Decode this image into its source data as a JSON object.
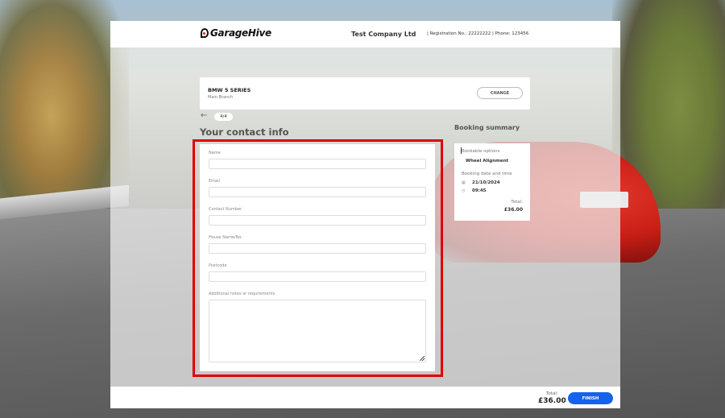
{
  "header": {
    "logo_text": "GarageHive",
    "company_name": "Test Company Ltd",
    "registration": "|  Registration No.: 22222222  |  Phone: 123456"
  },
  "vehicle": {
    "title": "BMW 5 SERIES",
    "branch": "Main Branch",
    "change_label": "CHANGE"
  },
  "step": {
    "back_symbol": "←",
    "indicator": "4/4"
  },
  "form": {
    "title": "Your contact info",
    "fields": [
      {
        "label": "Name",
        "value": ""
      },
      {
        "label": "Email",
        "value": ""
      },
      {
        "label": "Contact Number",
        "value": ""
      },
      {
        "label": "House Name/No.",
        "value": ""
      },
      {
        "label": "Postcode",
        "value": ""
      }
    ],
    "notes_label": "Additional notes or requirements",
    "notes_value": ""
  },
  "summary": {
    "title": "Booking summary",
    "bookable_label": "Bookable options",
    "service": "Wheel Alignment",
    "date_label": "Booking date and time",
    "date": "21/10/2024",
    "time": "09:45",
    "total_label": "Total:",
    "total": "£36.00"
  },
  "footer": {
    "total_label": "Total:",
    "total": "£36.00",
    "finish_label": "FINISH"
  },
  "colors": {
    "accent": "#1463ea",
    "highlight": "#e00000"
  }
}
